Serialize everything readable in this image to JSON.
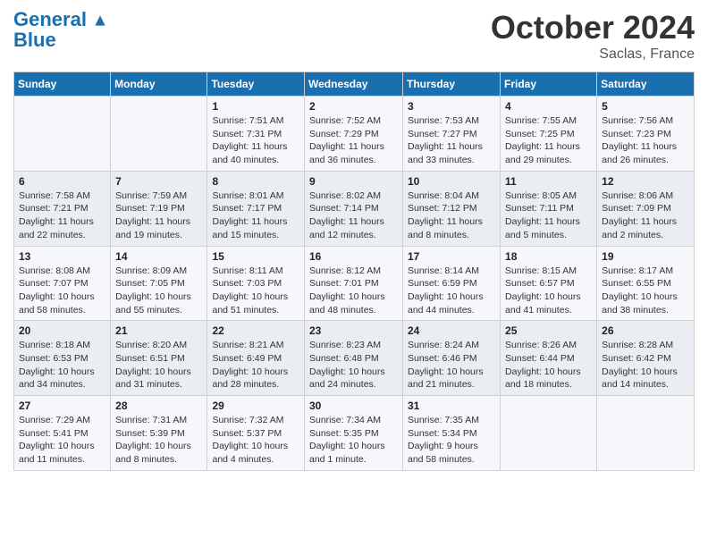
{
  "header": {
    "logo_line1": "General",
    "logo_line2": "Blue",
    "month": "October 2024",
    "location": "Saclas, France"
  },
  "weekdays": [
    "Sunday",
    "Monday",
    "Tuesday",
    "Wednesday",
    "Thursday",
    "Friday",
    "Saturday"
  ],
  "weeks": [
    [
      {
        "day": "",
        "sunrise": "",
        "sunset": "",
        "daylight": ""
      },
      {
        "day": "",
        "sunrise": "",
        "sunset": "",
        "daylight": ""
      },
      {
        "day": "1",
        "sunrise": "Sunrise: 7:51 AM",
        "sunset": "Sunset: 7:31 PM",
        "daylight": "Daylight: 11 hours and 40 minutes."
      },
      {
        "day": "2",
        "sunrise": "Sunrise: 7:52 AM",
        "sunset": "Sunset: 7:29 PM",
        "daylight": "Daylight: 11 hours and 36 minutes."
      },
      {
        "day": "3",
        "sunrise": "Sunrise: 7:53 AM",
        "sunset": "Sunset: 7:27 PM",
        "daylight": "Daylight: 11 hours and 33 minutes."
      },
      {
        "day": "4",
        "sunrise": "Sunrise: 7:55 AM",
        "sunset": "Sunset: 7:25 PM",
        "daylight": "Daylight: 11 hours and 29 minutes."
      },
      {
        "day": "5",
        "sunrise": "Sunrise: 7:56 AM",
        "sunset": "Sunset: 7:23 PM",
        "daylight": "Daylight: 11 hours and 26 minutes."
      }
    ],
    [
      {
        "day": "6",
        "sunrise": "Sunrise: 7:58 AM",
        "sunset": "Sunset: 7:21 PM",
        "daylight": "Daylight: 11 hours and 22 minutes."
      },
      {
        "day": "7",
        "sunrise": "Sunrise: 7:59 AM",
        "sunset": "Sunset: 7:19 PM",
        "daylight": "Daylight: 11 hours and 19 minutes."
      },
      {
        "day": "8",
        "sunrise": "Sunrise: 8:01 AM",
        "sunset": "Sunset: 7:17 PM",
        "daylight": "Daylight: 11 hours and 15 minutes."
      },
      {
        "day": "9",
        "sunrise": "Sunrise: 8:02 AM",
        "sunset": "Sunset: 7:14 PM",
        "daylight": "Daylight: 11 hours and 12 minutes."
      },
      {
        "day": "10",
        "sunrise": "Sunrise: 8:04 AM",
        "sunset": "Sunset: 7:12 PM",
        "daylight": "Daylight: 11 hours and 8 minutes."
      },
      {
        "day": "11",
        "sunrise": "Sunrise: 8:05 AM",
        "sunset": "Sunset: 7:11 PM",
        "daylight": "Daylight: 11 hours and 5 minutes."
      },
      {
        "day": "12",
        "sunrise": "Sunrise: 8:06 AM",
        "sunset": "Sunset: 7:09 PM",
        "daylight": "Daylight: 11 hours and 2 minutes."
      }
    ],
    [
      {
        "day": "13",
        "sunrise": "Sunrise: 8:08 AM",
        "sunset": "Sunset: 7:07 PM",
        "daylight": "Daylight: 10 hours and 58 minutes."
      },
      {
        "day": "14",
        "sunrise": "Sunrise: 8:09 AM",
        "sunset": "Sunset: 7:05 PM",
        "daylight": "Daylight: 10 hours and 55 minutes."
      },
      {
        "day": "15",
        "sunrise": "Sunrise: 8:11 AM",
        "sunset": "Sunset: 7:03 PM",
        "daylight": "Daylight: 10 hours and 51 minutes."
      },
      {
        "day": "16",
        "sunrise": "Sunrise: 8:12 AM",
        "sunset": "Sunset: 7:01 PM",
        "daylight": "Daylight: 10 hours and 48 minutes."
      },
      {
        "day": "17",
        "sunrise": "Sunrise: 8:14 AM",
        "sunset": "Sunset: 6:59 PM",
        "daylight": "Daylight: 10 hours and 44 minutes."
      },
      {
        "day": "18",
        "sunrise": "Sunrise: 8:15 AM",
        "sunset": "Sunset: 6:57 PM",
        "daylight": "Daylight: 10 hours and 41 minutes."
      },
      {
        "day": "19",
        "sunrise": "Sunrise: 8:17 AM",
        "sunset": "Sunset: 6:55 PM",
        "daylight": "Daylight: 10 hours and 38 minutes."
      }
    ],
    [
      {
        "day": "20",
        "sunrise": "Sunrise: 8:18 AM",
        "sunset": "Sunset: 6:53 PM",
        "daylight": "Daylight: 10 hours and 34 minutes."
      },
      {
        "day": "21",
        "sunrise": "Sunrise: 8:20 AM",
        "sunset": "Sunset: 6:51 PM",
        "daylight": "Daylight: 10 hours and 31 minutes."
      },
      {
        "day": "22",
        "sunrise": "Sunrise: 8:21 AM",
        "sunset": "Sunset: 6:49 PM",
        "daylight": "Daylight: 10 hours and 28 minutes."
      },
      {
        "day": "23",
        "sunrise": "Sunrise: 8:23 AM",
        "sunset": "Sunset: 6:48 PM",
        "daylight": "Daylight: 10 hours and 24 minutes."
      },
      {
        "day": "24",
        "sunrise": "Sunrise: 8:24 AM",
        "sunset": "Sunset: 6:46 PM",
        "daylight": "Daylight: 10 hours and 21 minutes."
      },
      {
        "day": "25",
        "sunrise": "Sunrise: 8:26 AM",
        "sunset": "Sunset: 6:44 PM",
        "daylight": "Daylight: 10 hours and 18 minutes."
      },
      {
        "day": "26",
        "sunrise": "Sunrise: 8:28 AM",
        "sunset": "Sunset: 6:42 PM",
        "daylight": "Daylight: 10 hours and 14 minutes."
      }
    ],
    [
      {
        "day": "27",
        "sunrise": "Sunrise: 7:29 AM",
        "sunset": "Sunset: 5:41 PM",
        "daylight": "Daylight: 10 hours and 11 minutes."
      },
      {
        "day": "28",
        "sunrise": "Sunrise: 7:31 AM",
        "sunset": "Sunset: 5:39 PM",
        "daylight": "Daylight: 10 hours and 8 minutes."
      },
      {
        "day": "29",
        "sunrise": "Sunrise: 7:32 AM",
        "sunset": "Sunset: 5:37 PM",
        "daylight": "Daylight: 10 hours and 4 minutes."
      },
      {
        "day": "30",
        "sunrise": "Sunrise: 7:34 AM",
        "sunset": "Sunset: 5:35 PM",
        "daylight": "Daylight: 10 hours and 1 minute."
      },
      {
        "day": "31",
        "sunrise": "Sunrise: 7:35 AM",
        "sunset": "Sunset: 5:34 PM",
        "daylight": "Daylight: 9 hours and 58 minutes."
      },
      {
        "day": "",
        "sunrise": "",
        "sunset": "",
        "daylight": ""
      },
      {
        "day": "",
        "sunrise": "",
        "sunset": "",
        "daylight": ""
      }
    ]
  ]
}
